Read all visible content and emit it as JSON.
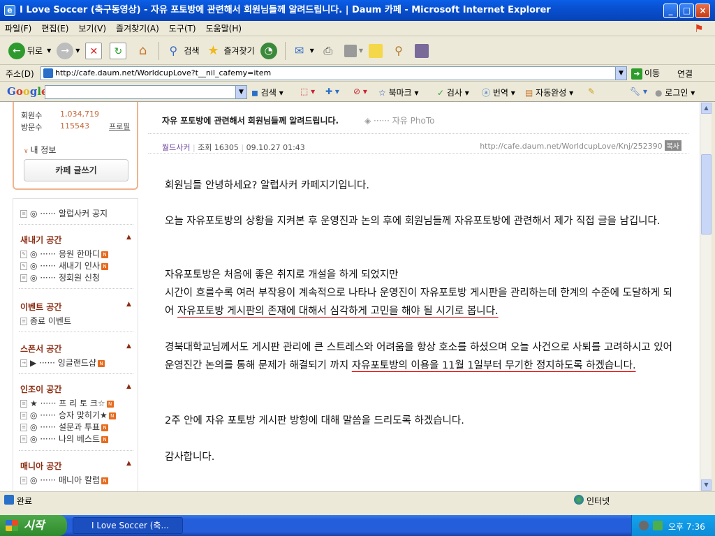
{
  "window": {
    "title": "I Love Soccer (축구동영상) - 자유 포토방에 관련해서 회원님들께 알려드립니다. | Daum 카페 - Microsoft Internet Explorer",
    "controls": [
      "_",
      "□",
      "×"
    ]
  },
  "menu": [
    "파일(F)",
    "편집(E)",
    "보기(V)",
    "즐겨찾기(A)",
    "도구(T)",
    "도움말(H)"
  ],
  "toolbar": {
    "back": "뒤로",
    "search": "검색",
    "favorites": "즐겨찾기"
  },
  "address": {
    "label": "주소(D)",
    "url": "http://cafe.daum.net/WorldcupLove?t__nil_cafemy=item",
    "go": "이동",
    "links": "연결"
  },
  "google": {
    "logo": "Google",
    "search": "검색",
    "bookmark": "북마크",
    "check": "검사",
    "translate": "번역",
    "autocomplete": "자동완성",
    "login": "로그인"
  },
  "sidebar": {
    "stats": [
      {
        "label": "회원수",
        "value": "1,034,719"
      },
      {
        "label": "방문수",
        "value": "115543"
      }
    ],
    "profile": "프로필",
    "my_info": "내 정보",
    "write": "카페 글쓰기",
    "notice": "◎ ······ 알럽사커 공지",
    "sections": [
      {
        "title": "새내기 공간",
        "items": [
          "◎ ······ 응원 한마디",
          "◎ ······ 새내기 인사",
          "◎ ······ 정회원 신청"
        ]
      },
      {
        "title": "이벤트 공간",
        "items": [
          "종료 이벤트"
        ]
      },
      {
        "title": "스폰서 공간",
        "items": [
          "▶ ······ 잉글랜드샵"
        ]
      },
      {
        "title": "인조이 공간",
        "items": [
          "★ ······ 프 리 토 크☆",
          "◎ ······ 승자 맞히기★",
          "◎ ······ 설문과 투표",
          "◎ ······ 나의 베스트"
        ]
      },
      {
        "title": "매니아 공간",
        "items": [
          "◎ ······ 매니아 칼럼"
        ]
      }
    ]
  },
  "post": {
    "title": "자유 포토방에 관련해서 회원님들께 알려드립니다.",
    "category": "◈ ······ 자유 PhoTo",
    "author": "월드사커",
    "views_label": "조회 16305",
    "date": "09.10.27 01:43",
    "url": "http://cafe.daum.net/WorldcupLove/Knj/252390",
    "copy": "복사",
    "p1": "회원님들 안녕하세요? 알럽사커 카페지기입니다.",
    "p2": "오늘 자유포토방의 상황을 지켜본 후 운영진과 논의 후에 회원님들께 자유포토방에 관련해서 제가 직접 글을 남깁니다.",
    "p3a": "자유포토방은 처음에 좋은 취지로 개설을 하게 되었지만",
    "p3b": "시간이 흐를수록 여러 부작용이 계속적으로 나타나 운영진이 자유포토방 게시판을 관리하는데 한계의 수준에 도달하게 되어 ",
    "p3u": "자유포토방 게시판의 존재에 대해서 심각하게 고민을 해야 될 시기로 봅니다.",
    "p4a": "경북대학교님께서도 게시판 관리에 큰 스트레스와 어려움을 항상 호소를 하셨으며 오늘 사건으로 사퇴를 고려하시고 있어 운영진간 논의를 통해 문제가 해결되기 까지 ",
    "p4u": "자유포토방의 이용을 11월 1일부터 무기한 정지하도록 하겠습니다.",
    "p5": "2주 안에 자유 포토방 게시판 방향에 대해 말씀을 드리도록 하겠습니다.",
    "p6": "감사합니다."
  },
  "status": {
    "text": "완료",
    "zone": "인터넷"
  },
  "taskbar": {
    "start": "시작",
    "task": "I Love Soccer (축...",
    "clock": "오후 7:36"
  }
}
